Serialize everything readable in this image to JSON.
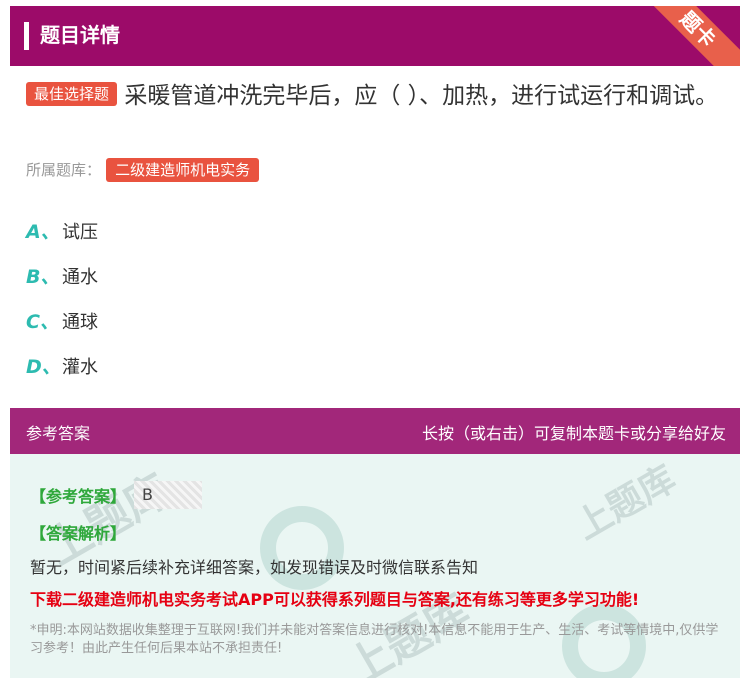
{
  "header": {
    "title": "题目详情",
    "ribbon": "题卡"
  },
  "question": {
    "type_badge": "最佳选择题",
    "text": "采暖管道冲洗完毕后，应（  ）、加热，进行试运行和调试。",
    "library_label": "所属题库：",
    "library_name": "二级建造师机电实务"
  },
  "options": [
    {
      "letter": "A、",
      "text": "试压"
    },
    {
      "letter": "B、",
      "text": "通水"
    },
    {
      "letter": "C、",
      "text": "通球"
    },
    {
      "letter": "D、",
      "text": "灌水"
    }
  ],
  "answer_section": {
    "title": "参考答案",
    "share_hint": "长按（或右击）可复制本题卡或分享给好友",
    "reference_label": "【参考答案】",
    "reference_value": "B",
    "analysis_label": "【答案解析】",
    "analysis_text": "暂无，时间紧后续补充详细答案，如发现错误及时微信联系告知",
    "promo": "下载二级建造师机电实务考试APP可以获得系列题目与答案,还有练习等更多学习功能!",
    "disclaimer": "*申明:本网站数据收集整理于互联网!我们并未能对答案信息进行核对!本信息不能用于生产、生活、考试等情境中,仅供学习参考！由此产生任何后果本站不承担责任!"
  },
  "colors": {
    "header_bg": "#9c0b69",
    "answer_header_bg": "#a2277a",
    "badge": "#e9533f",
    "option_letter": "#2dbbb0",
    "label_green": "#2fa83b",
    "promo_red": "#e60012",
    "answer_body_bg": "#eaf6f3"
  }
}
